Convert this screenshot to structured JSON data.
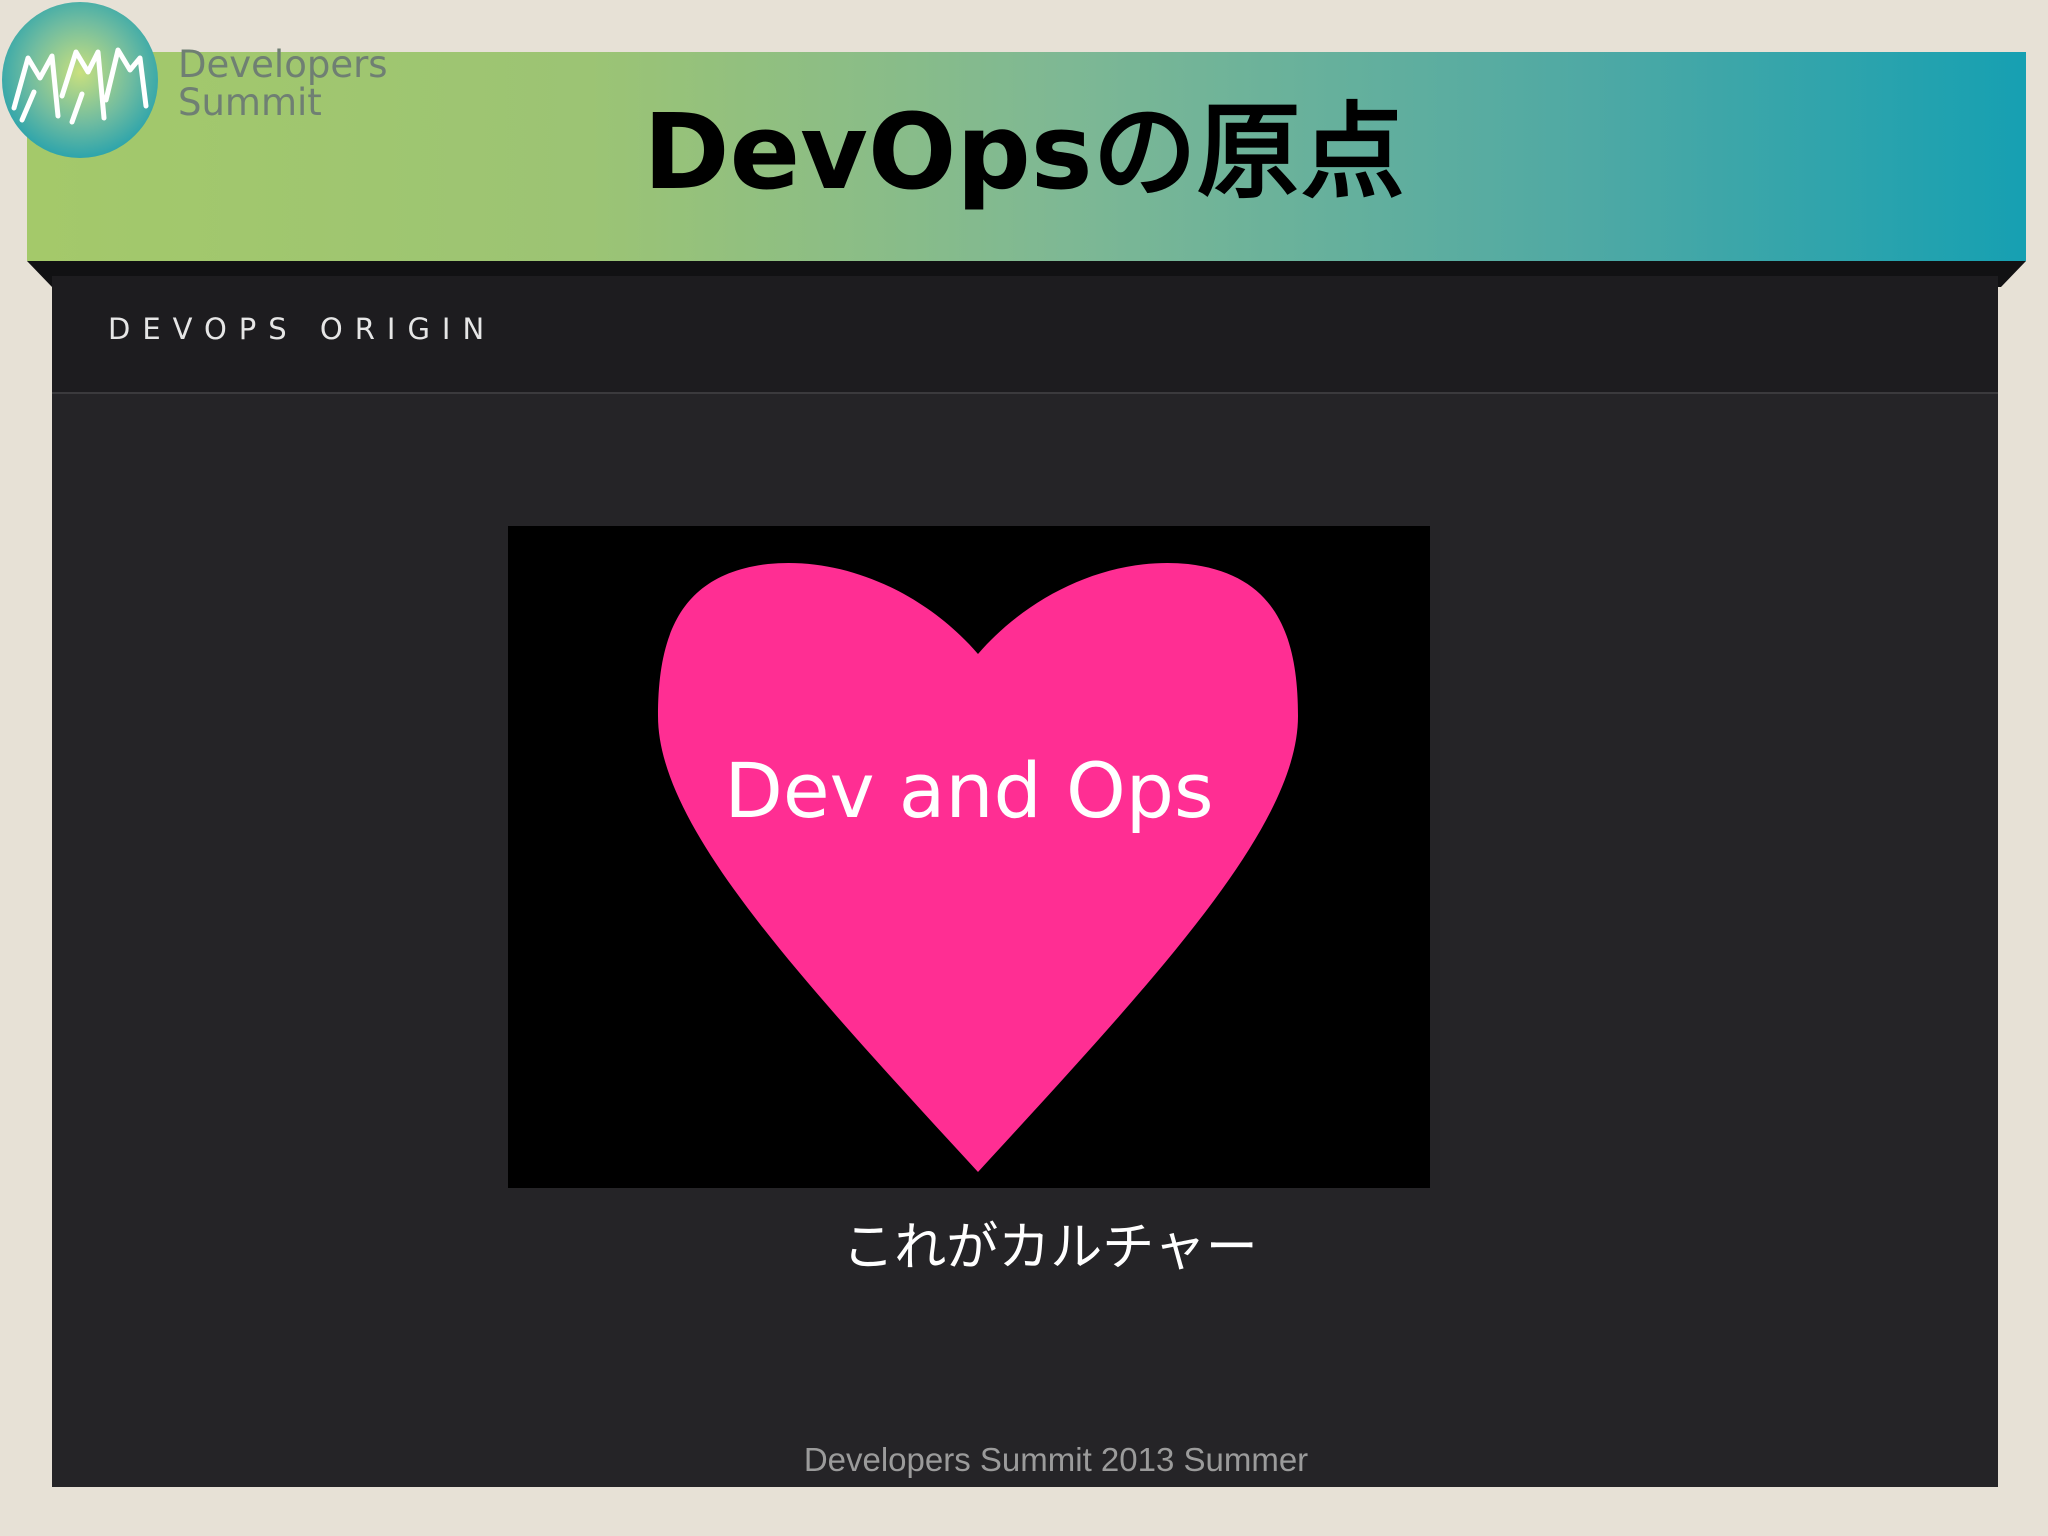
{
  "header": {
    "brand_line1": "Developers",
    "brand_line2": "Summit",
    "title": "DevOpsの原点",
    "gradient_start": "#a4c96a",
    "gradient_end": "#16a0b2"
  },
  "logo": {
    "icon": "developers-summit-logo-icon",
    "color": "#2aa3a7"
  },
  "subheader": {
    "label": "DEVOPS ORIGIN"
  },
  "main": {
    "heart_label": "Dev and Ops",
    "heart_color": "#ff2e93",
    "caption": "これがカルチャー"
  },
  "footer": {
    "text": "Developers Summit 2013 Summer"
  }
}
